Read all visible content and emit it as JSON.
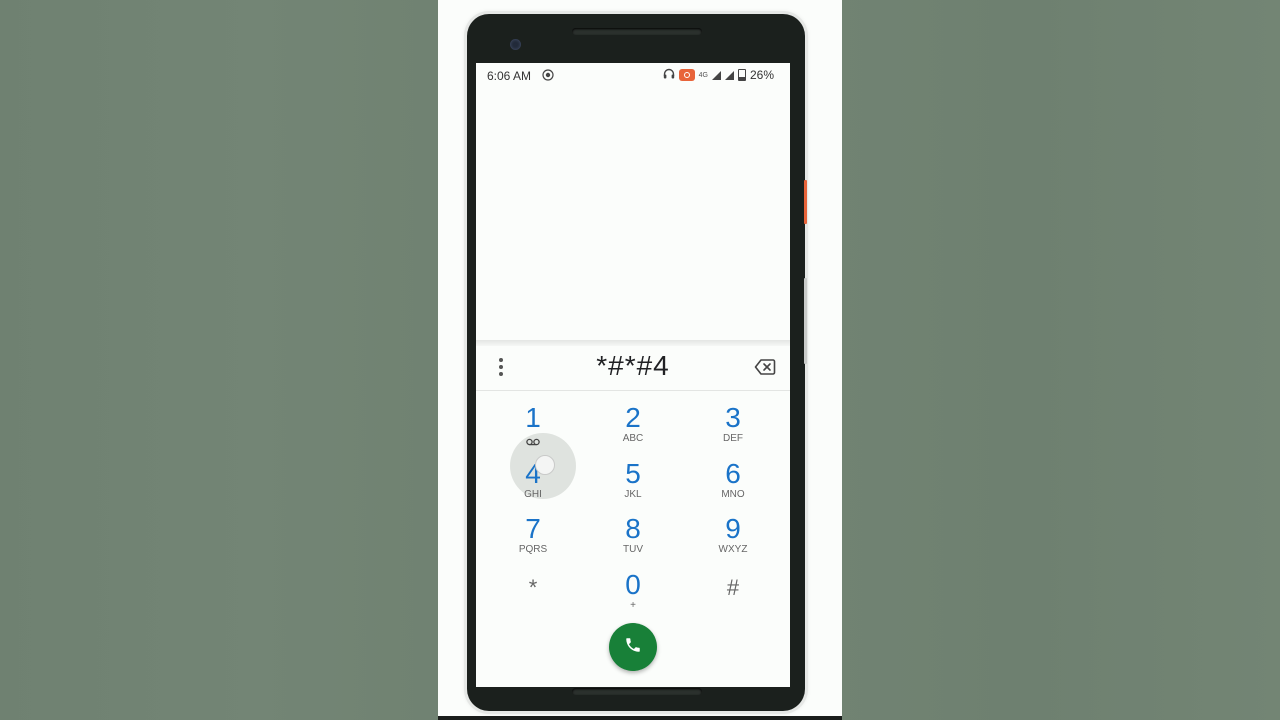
{
  "status_bar": {
    "time": "6:06 AM",
    "network_label": "4G",
    "battery_percent": "26%",
    "icons": [
      "screen-record-icon",
      "headphones-icon",
      "recording-badge-icon",
      "signal-icon",
      "signal-icon",
      "battery-icon"
    ]
  },
  "dialer": {
    "entered_digits": "*#*#4",
    "overflow_icon": "overflow-menu-icon",
    "backspace_icon": "backspace-icon",
    "call_icon": "phone-icon",
    "call_button_color": "#188038",
    "digit_color": "#1a73c8",
    "keys": [
      {
        "num": "1",
        "letters": ""
      },
      {
        "num": "2",
        "letters": "ABC"
      },
      {
        "num": "3",
        "letters": "DEF"
      },
      {
        "num": "4",
        "letters": "GHI"
      },
      {
        "num": "5",
        "letters": "JKL"
      },
      {
        "num": "6",
        "letters": "MNO"
      },
      {
        "num": "7",
        "letters": "PQRS"
      },
      {
        "num": "8",
        "letters": "TUV"
      },
      {
        "num": "9",
        "letters": "WXYZ"
      },
      {
        "num": "*",
        "letters": ""
      },
      {
        "num": "0",
        "letters": "+"
      },
      {
        "num": "#",
        "letters": ""
      }
    ]
  }
}
